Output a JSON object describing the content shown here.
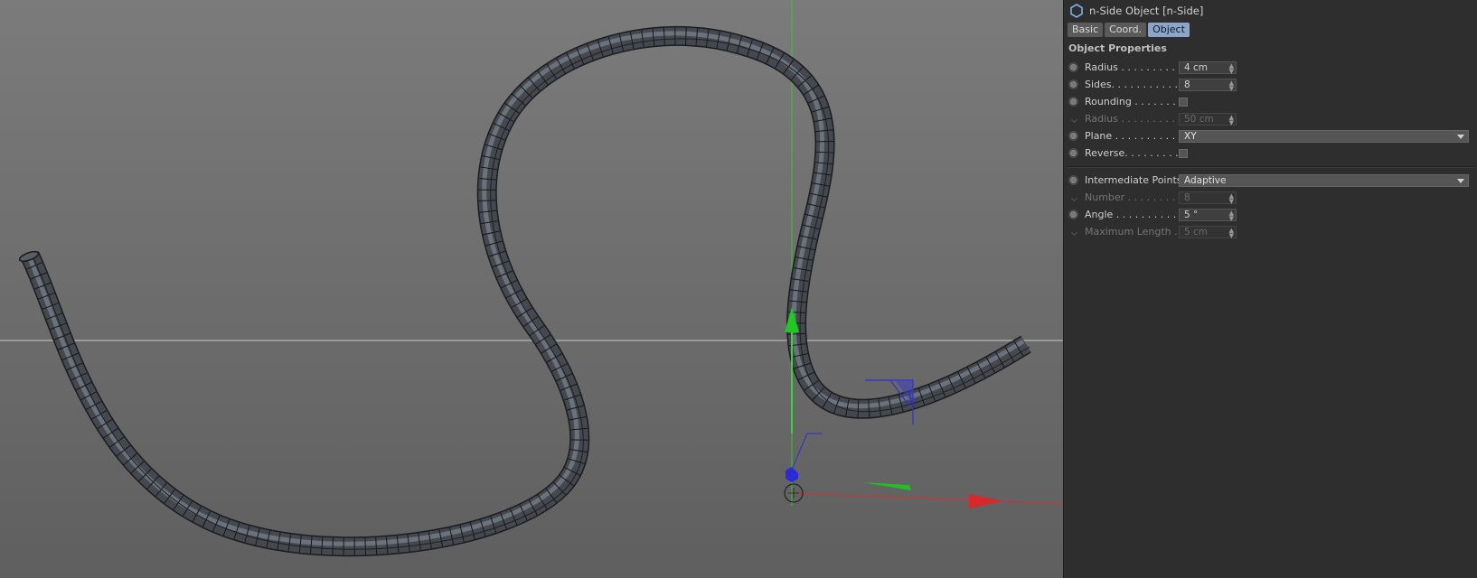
{
  "panel": {
    "title": "n-Side Object [n-Side]",
    "tabs": [
      "Basic",
      "Coord.",
      "Object"
    ],
    "active_tab": "Object",
    "section_title": "Object Properties",
    "rows": [
      {
        "label": "Radius . . . . . . . . . .",
        "value": "4 cm"
      },
      {
        "label": "Sides. . . . . . . . . . . .",
        "value": "8"
      },
      {
        "label": "Rounding . . . . . . .",
        "value": ""
      },
      {
        "label": "Radius . . . . . . . . . .",
        "value": "50 cm"
      },
      {
        "label": "Plane . . . . . . . . . . .",
        "value": "XY"
      },
      {
        "label": "Reverse. . . . . . . . . .",
        "value": ""
      }
    ],
    "rows2": [
      {
        "label": "Intermediate Points",
        "value": "Adaptive"
      },
      {
        "label": "Number . . . . . . . . .",
        "value": "8"
      },
      {
        "label": "Angle . . . . . . . . . . .",
        "value": "5 °"
      },
      {
        "label": "Maximum Length .",
        "value": "5 cm"
      }
    ]
  },
  "colors": {
    "viewport_bg": "#6f6f6f",
    "panel_bg": "#2e2e2e",
    "active_tab": "#8da6c8",
    "axis_x": "#e02020",
    "axis_y": "#20c020",
    "axis_z": "#2020e0",
    "tube": "#3c3f44"
  },
  "icons": [
    "n-side-object-icon",
    "animation-dot-icon",
    "dropdown-arrow-icon",
    "spin-arrows-icon"
  ]
}
